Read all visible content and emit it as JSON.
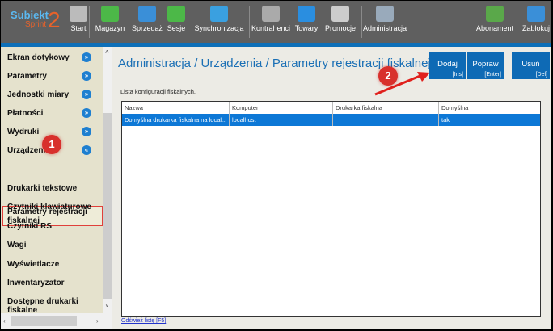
{
  "app": {
    "logo_line1": "Subiekt",
    "logo_line2": "Sprint",
    "logo_num": "2"
  },
  "toolbar": [
    {
      "label": "Start",
      "icon": "store-icon",
      "color": "#bbbbbb"
    },
    {
      "label": "Magazyn",
      "icon": "warehouse-icon",
      "color": "#4cb848"
    },
    {
      "label": "Sprzedaż",
      "icon": "sales-icon",
      "color": "#3a8fd8"
    },
    {
      "label": "Sesje",
      "icon": "user-session-icon",
      "color": "#4cb848"
    },
    {
      "label": "Synchronizacja",
      "icon": "sync-icon",
      "color": "#3aa0e0"
    },
    {
      "label": "Kontrahenci",
      "icon": "contractors-icon",
      "color": "#aaaaaa"
    },
    {
      "label": "Towary",
      "icon": "goods-icon",
      "color": "#2a8ee0"
    },
    {
      "label": "Promocje",
      "icon": "promo-tag-icon",
      "color": "#cccccc"
    },
    {
      "label": "Administracja",
      "icon": "tools-icon",
      "color": "#9ab"
    },
    {
      "label": "Abonament",
      "icon": "shield-check-icon",
      "color": "#5aa84a"
    },
    {
      "label": "Zablokuj",
      "icon": "lock-icon",
      "color": "#3a8fd8"
    }
  ],
  "sidebar": {
    "items": [
      {
        "label": "Ekran dotykowy",
        "chev": "»"
      },
      {
        "label": "Parametry",
        "chev": "»"
      },
      {
        "label": "Jednostki miary",
        "chev": "»"
      },
      {
        "label": "Płatności",
        "chev": "»"
      },
      {
        "label": "Wydruki",
        "chev": "»"
      },
      {
        "label": "Urządzenia",
        "chev": "«"
      }
    ],
    "selected": "Parametry rejestracji fiskalnej",
    "subitems": [
      "Drukarki tekstowe",
      "Czytniki klawiaturowe",
      "Czytniki RS",
      "Wagi",
      "Wyświetlacze",
      "Inwentaryzator",
      "Dostępne drukarki fiskalne"
    ]
  },
  "main": {
    "title": "Administracja / Urządzenia / Parametry rejestracji fiskalnej",
    "buttons": [
      {
        "label": "Dodaj",
        "key": "[Ins]"
      },
      {
        "label": "Popraw",
        "key": "[Enter]"
      },
      {
        "label": "Usuń",
        "key": "[Del]"
      }
    ],
    "caption": "Lista konfiguracji fiskalnych.",
    "columns": [
      "Nazwa",
      "Komputer",
      "Drukarka fiskalna",
      "Domyślna"
    ],
    "rows": [
      [
        "Domyślna drukarka fiskalna na local...",
        "localhost",
        "",
        "tak"
      ]
    ],
    "refresh": "Odśwież listę [F5]"
  },
  "annotations": {
    "badge1": "1",
    "badge2": "2"
  }
}
